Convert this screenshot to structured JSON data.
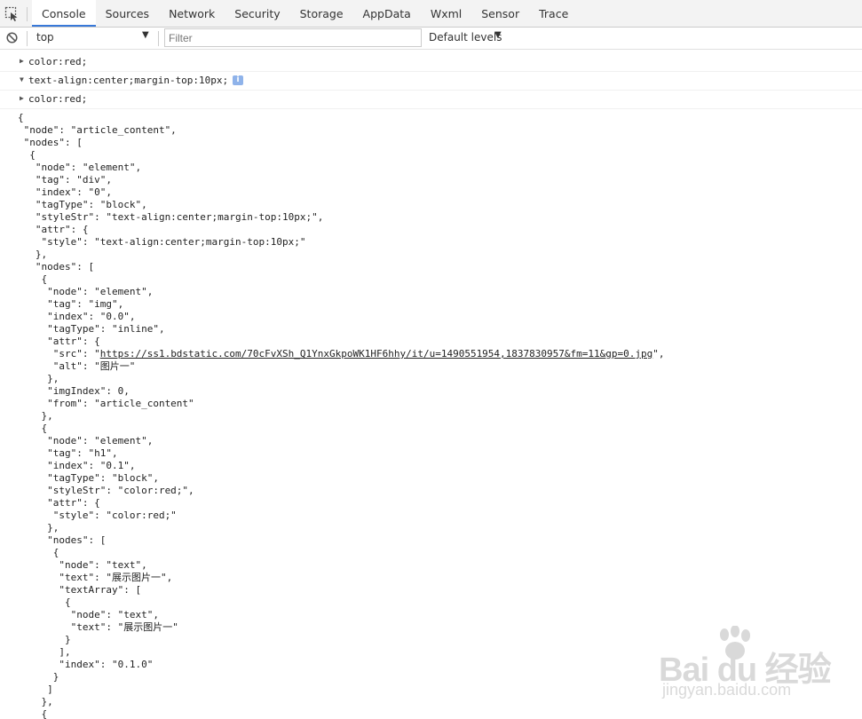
{
  "tabs": [
    {
      "label": "Console",
      "active": true
    },
    {
      "label": "Sources"
    },
    {
      "label": "Network"
    },
    {
      "label": "Security"
    },
    {
      "label": "Storage"
    },
    {
      "label": "AppData"
    },
    {
      "label": "Wxml"
    },
    {
      "label": "Sensor"
    },
    {
      "label": "Trace"
    }
  ],
  "toolbar": {
    "context": "top",
    "filter_placeholder": "Filter",
    "levels": "Default levels"
  },
  "messages": [
    {
      "text": "color:red;",
      "expanded": false
    },
    {
      "text": "text-align:center;margin-top:10px;",
      "expanded": true
    },
    {
      "text": "color:red;",
      "expanded": false
    }
  ],
  "json_output": {
    "before_link": "{\n \"node\": \"article_content\",\n \"nodes\": [\n  {\n   \"node\": \"element\",\n   \"tag\": \"div\",\n   \"index\": \"0\",\n   \"tagType\": \"block\",\n   \"styleStr\": \"text-align:center;margin-top:10px;\",\n   \"attr\": {\n    \"style\": \"text-align:center;margin-top:10px;\"\n   },\n   \"nodes\": [\n    {\n     \"node\": \"element\",\n     \"tag\": \"img\",\n     \"index\": \"0.0\",\n     \"tagType\": \"inline\",\n     \"attr\": {\n      \"src\": \"",
    "link": "https://ss1.bdstatic.com/70cFvXSh_Q1YnxGkpoWK1HF6hhy/it/u=1490551954,1837830957&fm=11&gp=0.jpg",
    "after_link": "\",\n      \"alt\": \"图片一\"\n     },\n     \"imgIndex\": 0,\n     \"from\": \"article_content\"\n    },\n    {\n     \"node\": \"element\",\n     \"tag\": \"h1\",\n     \"index\": \"0.1\",\n     \"tagType\": \"block\",\n     \"styleStr\": \"color:red;\",\n     \"attr\": {\n      \"style\": \"color:red;\"\n     },\n     \"nodes\": [\n      {\n       \"node\": \"text\",\n       \"text\": \"展示图片一\",\n       \"textArray\": [\n        {\n         \"node\": \"text\",\n         \"text\": \"展示图片一\"\n        }\n       ],\n       \"index\": \"0.1.0\"\n      }\n     ]\n    },\n    {"
  },
  "watermark": {
    "brand": "Bai du 经验",
    "url": "jingyan.baidu.com"
  },
  "colors": {
    "active_tab_underline": "#3879d9",
    "tabbar_bg": "#f3f3f3",
    "info_badge": "#8fb3ea"
  }
}
